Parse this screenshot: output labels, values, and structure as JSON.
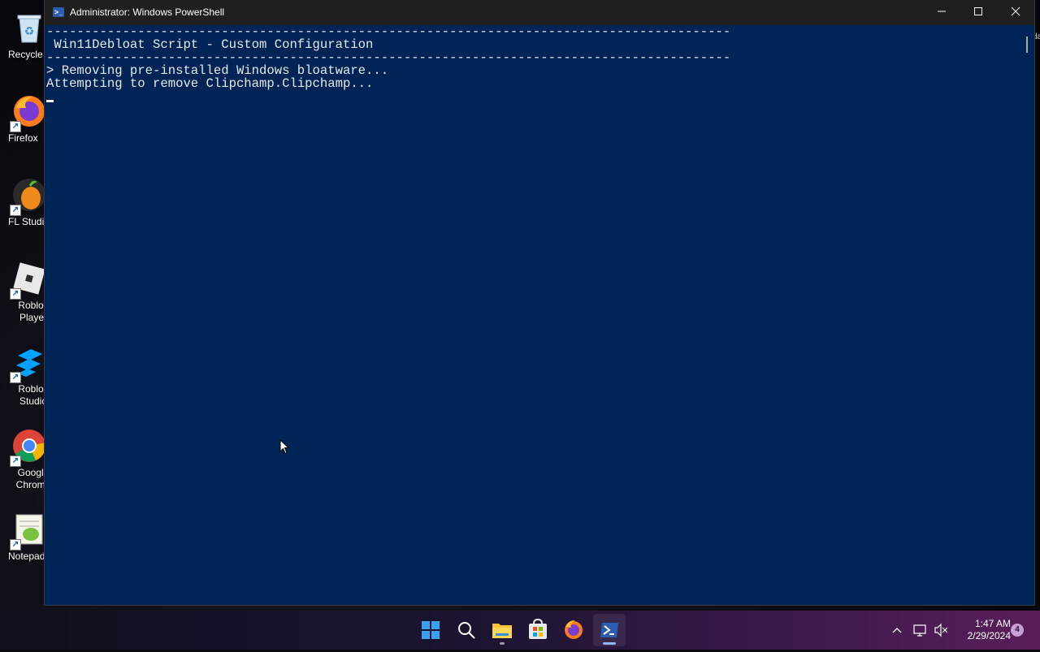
{
  "desktop": {
    "icons": [
      {
        "label": "Recycle B",
        "icon": "recycle-bin-icon"
      },
      {
        "label": "Firefox",
        "icon": "firefox-icon"
      },
      {
        "label": "FL Studio",
        "icon": "fl-studio-icon"
      },
      {
        "label": "Roblox Player",
        "icon": "roblox-player-icon"
      },
      {
        "label": "Roblox Studio",
        "icon": "roblox-studio-icon"
      },
      {
        "label": "Google Chrome",
        "icon": "chrome-icon"
      },
      {
        "label": "Notepad-",
        "icon": "notepad-plus-icon"
      }
    ],
    "side_fragment": "da"
  },
  "window": {
    "title": "Administrator: Windows PowerShell",
    "controls": {
      "minimize": "—",
      "maximize": "☐",
      "close": "✕"
    }
  },
  "console": {
    "lines": [
      "------------------------------------------------------------------------------------------",
      " Win11Debloat Script - Custom Configuration",
      "------------------------------------------------------------------------------------------",
      "",
      "> Removing pre-installed Windows bloatware...",
      "Attempting to remove Clipchamp.Clipchamp..."
    ],
    "text_color": "#e8e8e8",
    "background": "#012456"
  },
  "taskbar": {
    "apps": [
      {
        "name": "start",
        "icon": "windows-start-icon"
      },
      {
        "name": "search",
        "icon": "search-icon"
      },
      {
        "name": "file-explorer",
        "icon": "folder-icon"
      },
      {
        "name": "store",
        "icon": "microsoft-store-icon"
      },
      {
        "name": "firefox",
        "icon": "firefox-icon"
      },
      {
        "name": "powershell",
        "icon": "powershell-icon",
        "active": true
      }
    ],
    "tray": {
      "time": "1:47 AM",
      "date": "2/29/2024",
      "notification_count": "4"
    }
  }
}
